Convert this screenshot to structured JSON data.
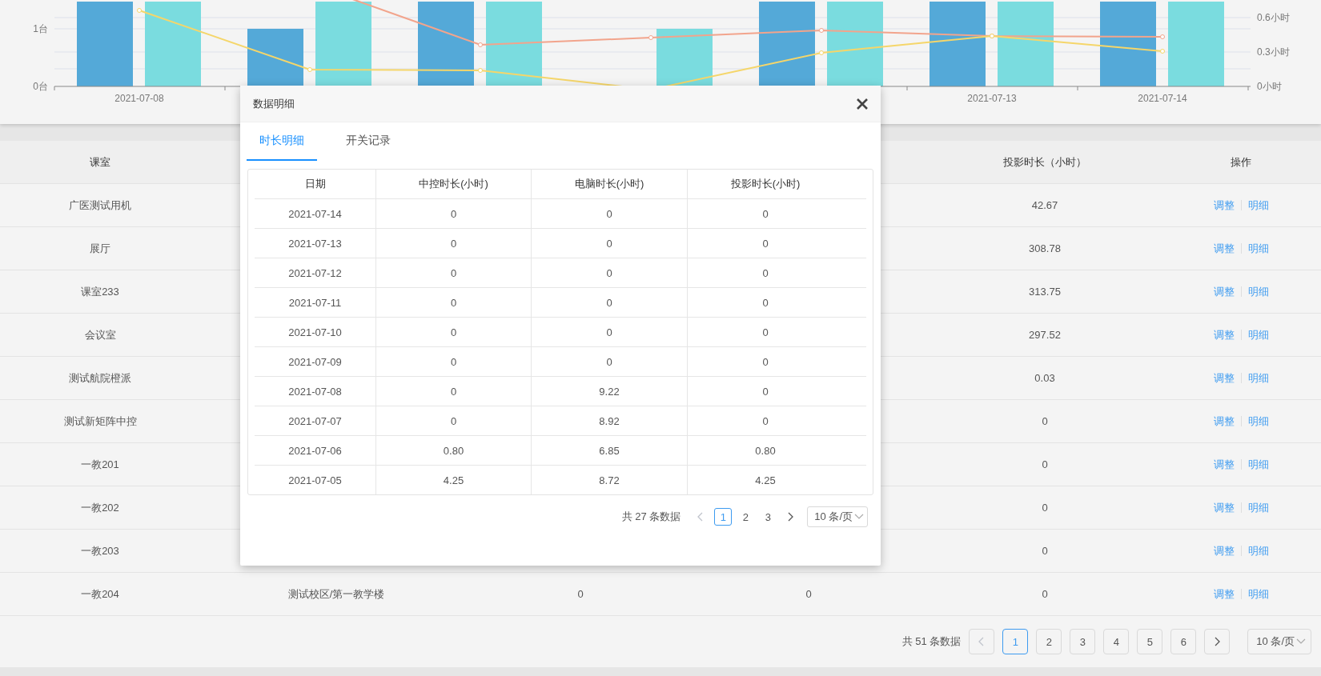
{
  "chart": {
    "left_axis_ticks": [
      "1台",
      "0台"
    ],
    "right_axis_ticks": [
      "0.6小时",
      "0.3小时",
      "0小时"
    ],
    "x_labels": [
      "2021-07-08",
      "2021-07-13",
      "2021-07-14"
    ]
  },
  "table": {
    "columns": [
      "课室",
      "投影时长（小时）",
      "操作"
    ],
    "rows": [
      {
        "room": "广医测试用机",
        "projection_hours": "42.67",
        "actions": [
          "调整",
          "明细"
        ]
      },
      {
        "room": "展厅",
        "projection_hours": "308.78",
        "actions": [
          "调整",
          "明细"
        ]
      },
      {
        "room": "课室233",
        "projection_hours": "313.75",
        "actions": [
          "调整",
          "明细"
        ]
      },
      {
        "room": "会议室",
        "projection_hours": "297.52",
        "actions": [
          "调整",
          "明细"
        ]
      },
      {
        "room": "测试航院橙派",
        "projection_hours": "0.03",
        "actions": [
          "调整",
          "明细"
        ]
      },
      {
        "room": "测试新矩阵中控",
        "projection_hours": "0",
        "actions": [
          "调整",
          "明细"
        ]
      },
      {
        "room": "一教201",
        "projection_hours": "0",
        "actions": [
          "调整",
          "明细"
        ]
      },
      {
        "room": "一教202",
        "projection_hours": "0",
        "actions": [
          "调整",
          "明细"
        ]
      },
      {
        "room": "一教203",
        "projection_hours": "0",
        "actions": [
          "调整",
          "明细"
        ]
      },
      {
        "room": "一教204",
        "column_2": "测试校区/第一教学楼",
        "column_3": "0",
        "column_4": "0",
        "projection_hours": "0",
        "actions": [
          "调整",
          "明细"
        ]
      }
    ]
  },
  "pagination": {
    "total": "共 51 条数据",
    "pages": [
      {
        "label": "1",
        "selected": true
      },
      {
        "label": "2",
        "selected": false
      },
      {
        "label": "3",
        "selected": false
      },
      {
        "label": "4",
        "selected": false
      },
      {
        "label": "5",
        "selected": false
      },
      {
        "label": "6",
        "selected": false
      }
    ],
    "page_size": "10 条/页"
  },
  "modal": {
    "title": "数据明细",
    "tabs": [
      {
        "label": "时长明细",
        "selected": true
      },
      {
        "label": "开关记录",
        "selected": false
      }
    ],
    "table": {
      "columns": [
        "日期",
        "中控时长(小时)",
        "电脑时长(小时)",
        "投影时长(小时)"
      ],
      "rows": [
        [
          "2021-07-14",
          "0",
          "0",
          "0"
        ],
        [
          "2021-07-13",
          "0",
          "0",
          "0"
        ],
        [
          "2021-07-12",
          "0",
          "0",
          "0"
        ],
        [
          "2021-07-11",
          "0",
          "0",
          "0"
        ],
        [
          "2021-07-10",
          "0",
          "0",
          "0"
        ],
        [
          "2021-07-09",
          "0",
          "0",
          "0"
        ],
        [
          "2021-07-08",
          "0",
          "9.22",
          "0"
        ],
        [
          "2021-07-07",
          "0",
          "8.92",
          "0"
        ],
        [
          "2021-07-06",
          "0.80",
          "6.85",
          "0.80"
        ],
        [
          "2021-07-05",
          "4.25",
          "8.72",
          "4.25"
        ]
      ]
    },
    "pagination": {
      "total": "共 27 条数据",
      "pages": [
        {
          "label": "1",
          "selected": true
        },
        {
          "label": "2",
          "selected": false
        },
        {
          "label": "3",
          "selected": false
        }
      ],
      "page_size": "10 条/页"
    }
  }
}
